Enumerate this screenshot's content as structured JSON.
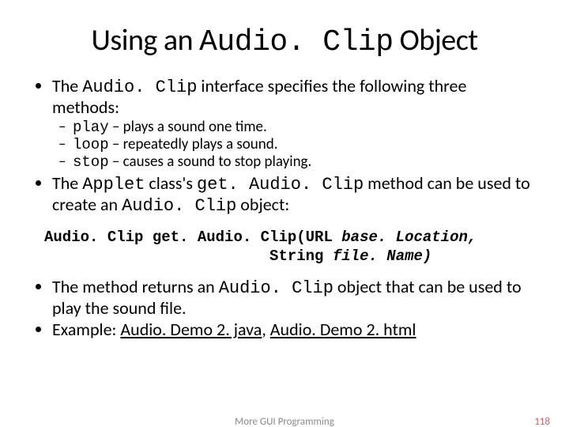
{
  "title": {
    "pre": "Using an ",
    "code": "Audio. Clip",
    "post": " Object"
  },
  "b1": {
    "pre": "The ",
    "code": "Audio. Clip",
    "post": " interface specifies the following three methods:"
  },
  "m_play": {
    "code": "play",
    "desc": " – plays a sound one time."
  },
  "m_loop": {
    "code": "loop",
    "desc": " – repeatedly plays a sound."
  },
  "m_stop": {
    "code": "stop",
    "desc": " –  causes a sound to stop playing."
  },
  "b2": {
    "pre": "The ",
    "code1": "Applet",
    "mid1": " class's ",
    "code2": "get. Audio. Clip",
    "mid2": " method can be used to create an ",
    "code3": "Audio. Clip",
    "post": " object:"
  },
  "sig": {
    "l1a": "Audio. Clip get. Audio. Clip(URL ",
    "l1b": "base. Location,",
    "l2pad": "                         ",
    "l2a": "String ",
    "l2b": "file. Name)"
  },
  "b3": {
    "pre": "The method returns an ",
    "code": "Audio. Clip",
    "post": " object that can be used to play the sound file."
  },
  "b4": {
    "pre": "Example: ",
    "link1": "Audio. Demo 2. java",
    "sep": ", ",
    "link2": "Audio. Demo 2. html"
  },
  "footer": {
    "text": "More GUI Programming",
    "page": "118"
  }
}
